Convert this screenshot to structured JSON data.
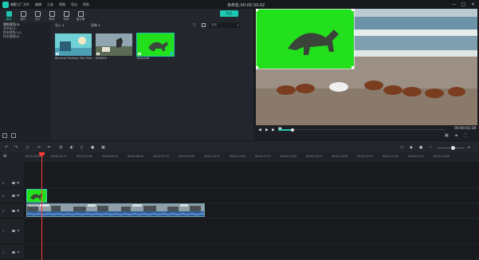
{
  "app": {
    "logo_text": "喵影工厂",
    "project_title": "未命名:00:00:30:02"
  },
  "menu": [
    "文件",
    "编辑",
    "工具",
    "视图",
    "导出",
    "帮助"
  ],
  "window_controls": [
    "—",
    "□",
    "✕"
  ],
  "media_tabs": [
    {
      "label": "媒体",
      "active": true
    },
    {
      "label": "音乐",
      "active": false
    },
    {
      "label": "文字",
      "active": false
    },
    {
      "label": "转场",
      "active": false
    },
    {
      "label": "特效",
      "active": false
    },
    {
      "label": "窗元素",
      "active": false
    }
  ],
  "export_label": "导出",
  "media_sidebar": [
    {
      "label": "我的项目(3)",
      "active": true
    },
    {
      "label": "文件夹(3)",
      "active": false
    },
    {
      "label": "样本颜色(15)",
      "active": false
    },
    {
      "label": "样本视频(8)",
      "active": false
    }
  ],
  "media_toolbar": {
    "import_label": "导入",
    "record_label": "录制",
    "search_placeholder": "搜索"
  },
  "media_items": [
    {
      "caption": "Musical Fantasy Set Film...",
      "selected": false
    },
    {
      "caption": "Wildlife",
      "selected": false
    },
    {
      "caption": "dino10b",
      "selected": true
    }
  ],
  "preview": {
    "timecode": "00:00:02:26",
    "progress": 0.09
  },
  "ruler_labels": [
    "00:00:00:00",
    "00:00:01:15",
    "00:00:03:00",
    "00:00:04:15",
    "00:00:06:00",
    "00:00:07:15",
    "00:00:09:00",
    "00:00:10:15",
    "00:00:12:00",
    "00:00:13:15",
    "00:00:15:00",
    "00:00:16:15",
    "00:00:18:00",
    "00:00:19:15",
    "00:00:21:00",
    "00:00:22:15",
    "00:00:24:00"
  ],
  "tracks": [
    {
      "num": "4"
    },
    {
      "num": "3"
    },
    {
      "num": "2"
    },
    {
      "num": "1"
    },
    {
      "num": "1"
    }
  ],
  "clips": {
    "video_label": "BLR Video 4"
  },
  "colors": {
    "accent": "#1ec9b3",
    "chroma_green": "#22e01b",
    "playhead": "#ff3b3b"
  }
}
